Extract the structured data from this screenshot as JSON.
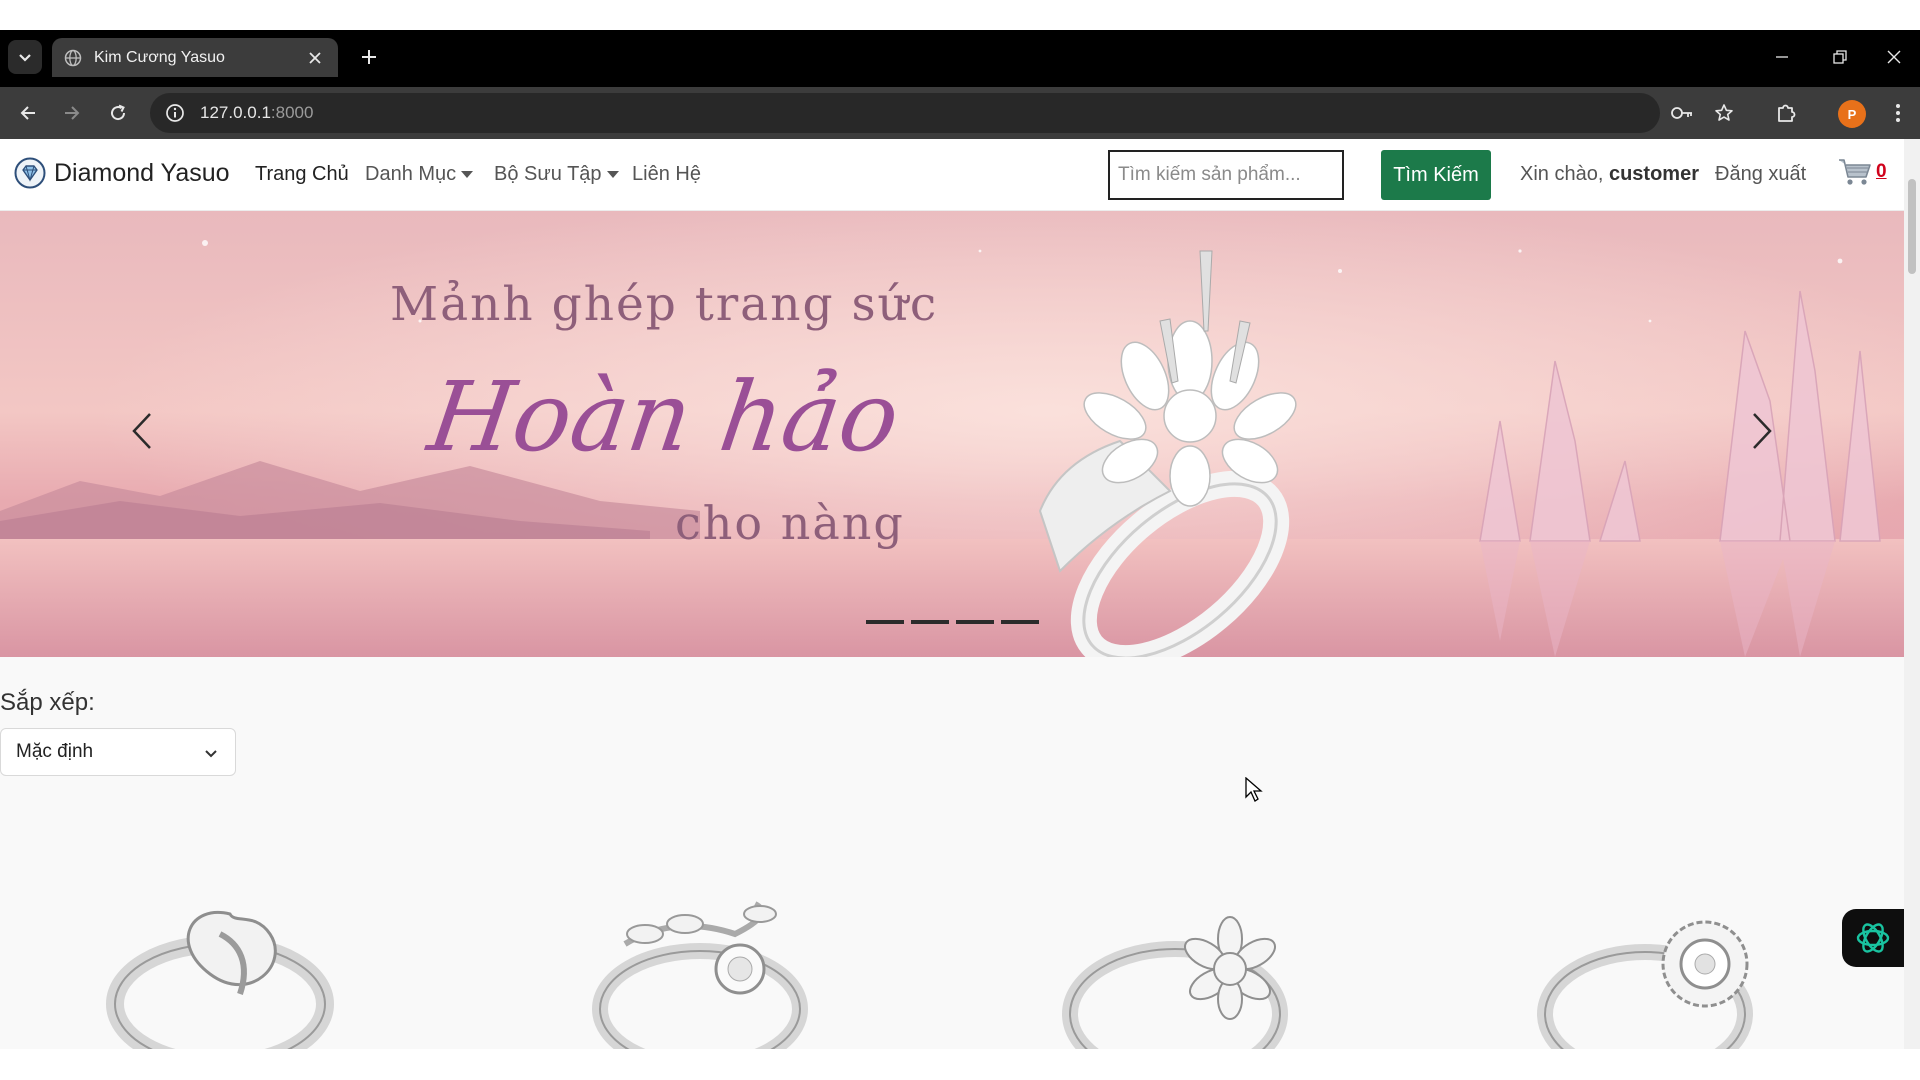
{
  "browser": {
    "tab_title": "Kim Cương Yasuo",
    "url_host": "127.0.0.1",
    "url_port": ":8000",
    "profile_initial": "P"
  },
  "navbar": {
    "brand": "Diamond Yasuo",
    "links": [
      "Trang Chủ",
      "Danh Mục",
      "Bộ Sưu Tập",
      "Liên Hệ"
    ],
    "search_placeholder": "Tìm kiếm sản phẩm...",
    "search_button": "Tìm Kiếm",
    "greeting_prefix": "Xin chào,",
    "username": "customer",
    "logout": "Đăng xuất",
    "cart_count": "0"
  },
  "banner": {
    "line1": "Mảnh ghép trang sức",
    "line2": "Hoàn hảo",
    "line3": "cho nàng",
    "slide_count": 4,
    "active_slide": 1
  },
  "sort": {
    "label": "Sắp xếp:",
    "selected": "Mặc định"
  },
  "colors": {
    "search_button_bg": "#1c7a4a",
    "cart_count": "#d0021b",
    "banner_script": "#9a4f96"
  },
  "icons": [
    "tab-search-icon",
    "globe-icon",
    "close-icon",
    "plus-icon",
    "back-icon",
    "forward-icon",
    "reload-icon",
    "info-icon",
    "key-icon",
    "star-icon",
    "extensions-icon",
    "kebab-menu-icon",
    "cart-icon",
    "chevron-left-icon",
    "chevron-right-icon",
    "chevron-down-icon",
    "chatgpt-icon"
  ]
}
